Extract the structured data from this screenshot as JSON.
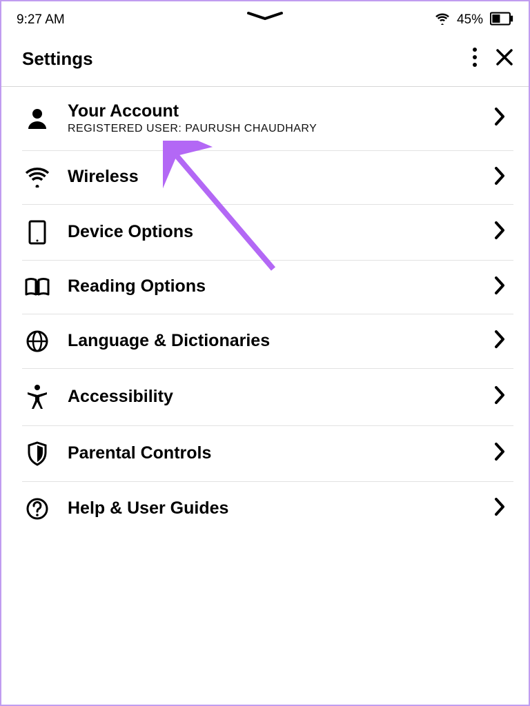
{
  "status_bar": {
    "time": "9:27 AM",
    "battery_pct": "45%"
  },
  "header": {
    "title": "Settings"
  },
  "rows": [
    {
      "title": "Your Account",
      "subtitle": "REGISTERED USER: PAURUSH CHAUDHARY"
    },
    {
      "title": "Wireless"
    },
    {
      "title": "Device Options"
    },
    {
      "title": "Reading Options"
    },
    {
      "title": "Language & Dictionaries"
    },
    {
      "title": "Accessibility"
    },
    {
      "title": "Parental Controls"
    },
    {
      "title": "Help & User Guides"
    }
  ],
  "annotation": {
    "arrow_color": "#b368f5"
  }
}
